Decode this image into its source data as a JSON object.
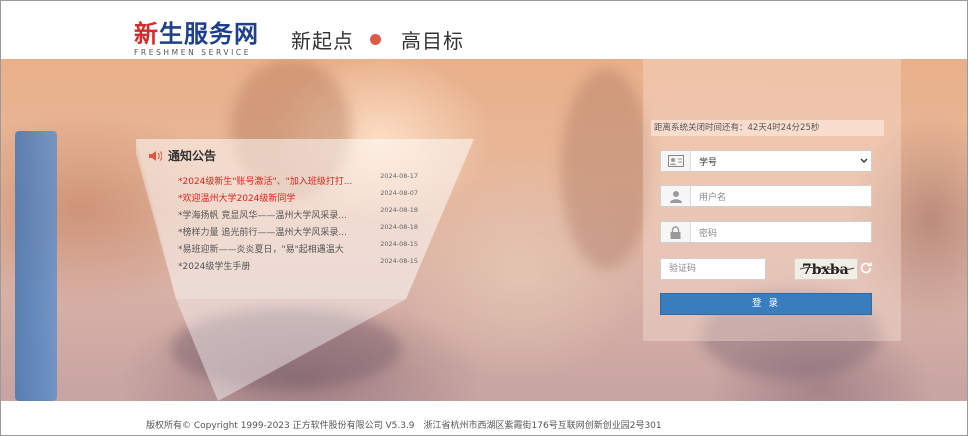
{
  "header": {
    "logo_text_red": "新",
    "logo_text_blue": "生服务网",
    "logo_subtitle": "FRESHMEN SERVICE",
    "slogan_left": "新起点",
    "slogan_right": "高目标"
  },
  "notice": {
    "title": "通知公告",
    "items": [
      {
        "title": "*2024级新生\"账号激活\"、\"加入班级打打...",
        "date": "2024-08-17",
        "highlight": true
      },
      {
        "title": "*欢迎温州大学2024级新同学",
        "date": "2024-08-07",
        "highlight": true
      },
      {
        "title": "*学海扬帆 竞显风华——温州大学风采录...",
        "date": "2024-08-18",
        "highlight": false
      },
      {
        "title": "*榜样力量 追光前行——温州大学风采录...",
        "date": "2024-08-18",
        "highlight": false
      },
      {
        "title": "*易班迎新——炎炎夏日，\"易\"起相遇温大",
        "date": "2024-08-15",
        "highlight": false
      },
      {
        "title": "*2024级学生手册",
        "date": "2024-08-15",
        "highlight": false
      }
    ]
  },
  "login": {
    "countdown": "距离系统关闭时间还有：42天4时24分25秒",
    "id_type_selected": "学号",
    "username_placeholder": "用户名",
    "password_placeholder": "密码",
    "captcha_placeholder": "验证码",
    "captcha_text": "7bxba",
    "login_label": "登 录"
  },
  "footer": {
    "text": "版权所有© Copyright 1999-2023 正方软件股份有限公司 V5.3.9　浙江省杭州市西湖区紫霞街176号互联网创新创业园2号301"
  },
  "colors": {
    "brand_blue": "#1e3f8c",
    "brand_red": "#d42b2b",
    "login_button": "#3a7dbf",
    "notice_highlight": "#e0211c"
  }
}
